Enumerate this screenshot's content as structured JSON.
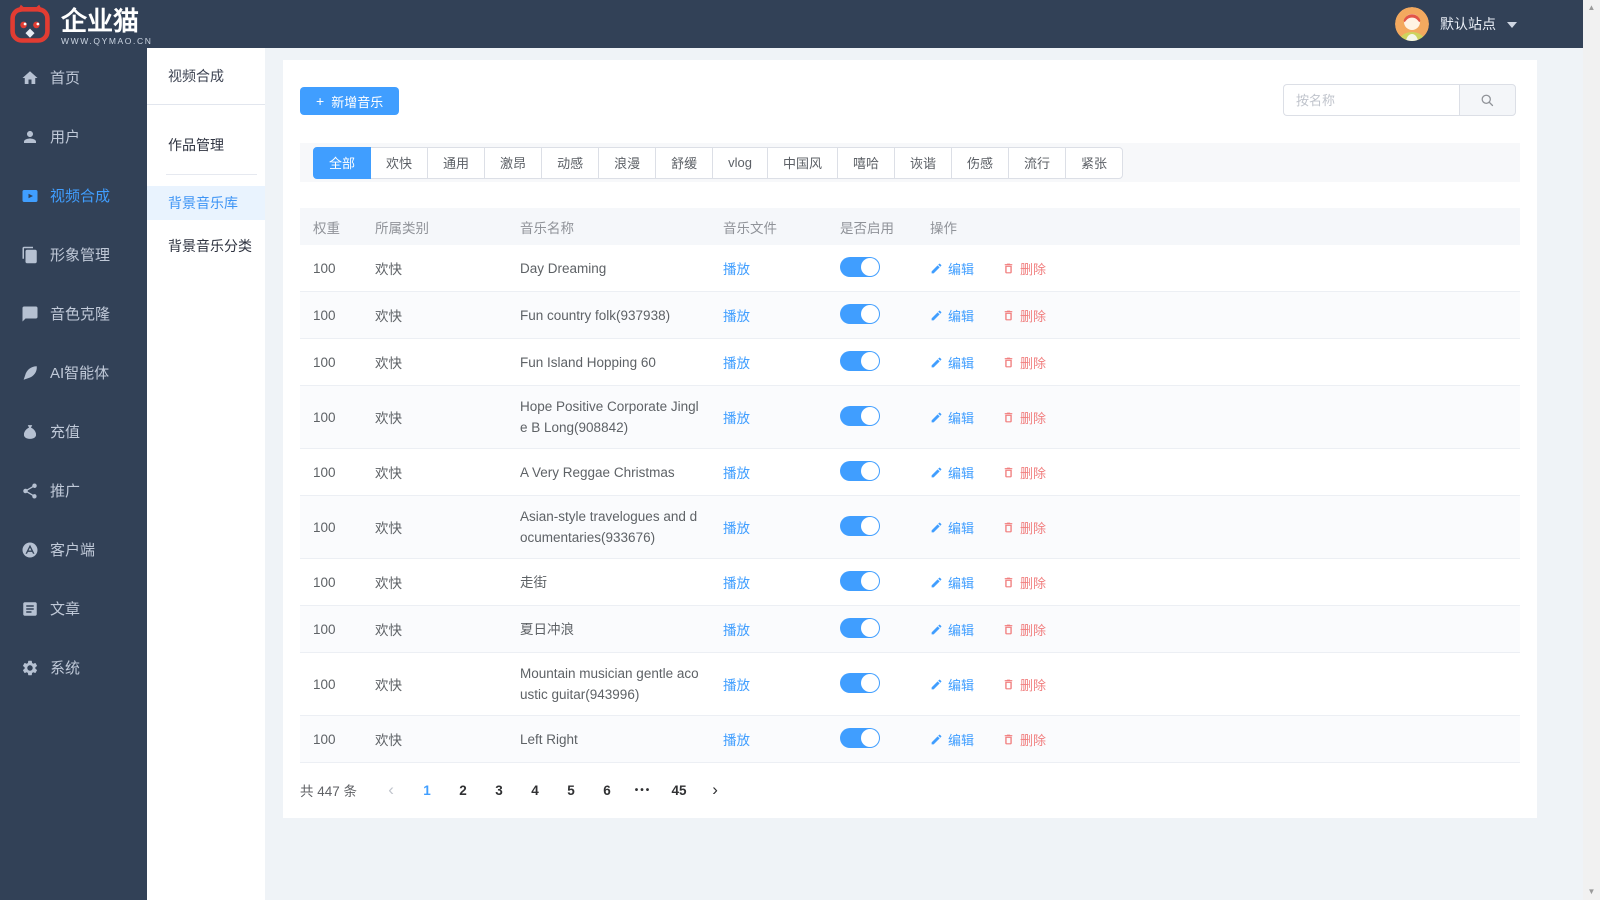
{
  "brand": {
    "name": "企业猫",
    "site_url": "WWW.QYMAO.CN"
  },
  "topbar": {
    "site_label": "默认站点"
  },
  "sidebar": {
    "items": [
      {
        "label": "首页",
        "icon": "home-icon",
        "active": false
      },
      {
        "label": "用户",
        "icon": "user-icon",
        "active": false
      },
      {
        "label": "视频合成",
        "icon": "video-icon",
        "active": true
      },
      {
        "label": "形象管理",
        "icon": "image-icon",
        "active": false
      },
      {
        "label": "音色克隆",
        "icon": "voice-icon",
        "active": false
      },
      {
        "label": "AI智能体",
        "icon": "feather-icon",
        "active": false
      },
      {
        "label": "充值",
        "icon": "moneybag-icon",
        "active": false
      },
      {
        "label": "推广",
        "icon": "share-icon",
        "active": false
      },
      {
        "label": "客户端",
        "icon": "appstore-icon",
        "active": false
      },
      {
        "label": "文章",
        "icon": "article-icon",
        "active": false
      },
      {
        "label": "系统",
        "icon": "gear-icon",
        "active": false
      }
    ]
  },
  "submenu": {
    "title": "视频合成",
    "works": "作品管理",
    "library": "背景音乐库",
    "category": "背景音乐分类",
    "active": "背景音乐库"
  },
  "toolbar": {
    "plus": "+",
    "add_label": "新增音乐",
    "search_placeholder": "按名称"
  },
  "filters": {
    "active": "全部",
    "items": [
      "全部",
      "欢快",
      "通用",
      "激昂",
      "动感",
      "浪漫",
      "舒缓",
      "vlog",
      "中国风",
      "嘻哈",
      "诙谐",
      "伤感",
      "流行",
      "紧张"
    ]
  },
  "table": {
    "columns": [
      "权重",
      "所属类别",
      "音乐名称",
      "音乐文件",
      "是否启用",
      "操作"
    ],
    "labels": {
      "play": "播放",
      "edit": "编辑",
      "delete": "删除"
    },
    "rows": [
      {
        "weight": "100",
        "category": "欢快",
        "name": "Day Dreaming",
        "enabled": true
      },
      {
        "weight": "100",
        "category": "欢快",
        "name": "Fun country folk(937938)",
        "enabled": true
      },
      {
        "weight": "100",
        "category": "欢快",
        "name": "Fun Island Hopping 60",
        "enabled": true
      },
      {
        "weight": "100",
        "category": "欢快",
        "name": "Hope Positive Corporate Jingle B Long(908842)",
        "enabled": true
      },
      {
        "weight": "100",
        "category": "欢快",
        "name": "A Very Reggae Christmas",
        "enabled": true
      },
      {
        "weight": "100",
        "category": "欢快",
        "name": "Asian-style travelogues and documentaries(933676)",
        "enabled": true
      },
      {
        "weight": "100",
        "category": "欢快",
        "name": "走街",
        "enabled": true
      },
      {
        "weight": "100",
        "category": "欢快",
        "name": "夏日冲浪",
        "enabled": true
      },
      {
        "weight": "100",
        "category": "欢快",
        "name": "Mountain musician gentle acoustic guitar(943996)",
        "enabled": true
      },
      {
        "weight": "100",
        "category": "欢快",
        "name": "Left Right",
        "enabled": true
      }
    ]
  },
  "pagination": {
    "total_label": "共 447 条",
    "prev": "‹",
    "next": "›",
    "pages": [
      "1",
      "2",
      "3",
      "4",
      "5",
      "6",
      "•••",
      "45"
    ],
    "active": "1"
  },
  "colors": {
    "accent": "#409eff",
    "sidebar_bg": "#324157",
    "danger": "#f17e7e",
    "page_bg": "#eff3f7"
  }
}
